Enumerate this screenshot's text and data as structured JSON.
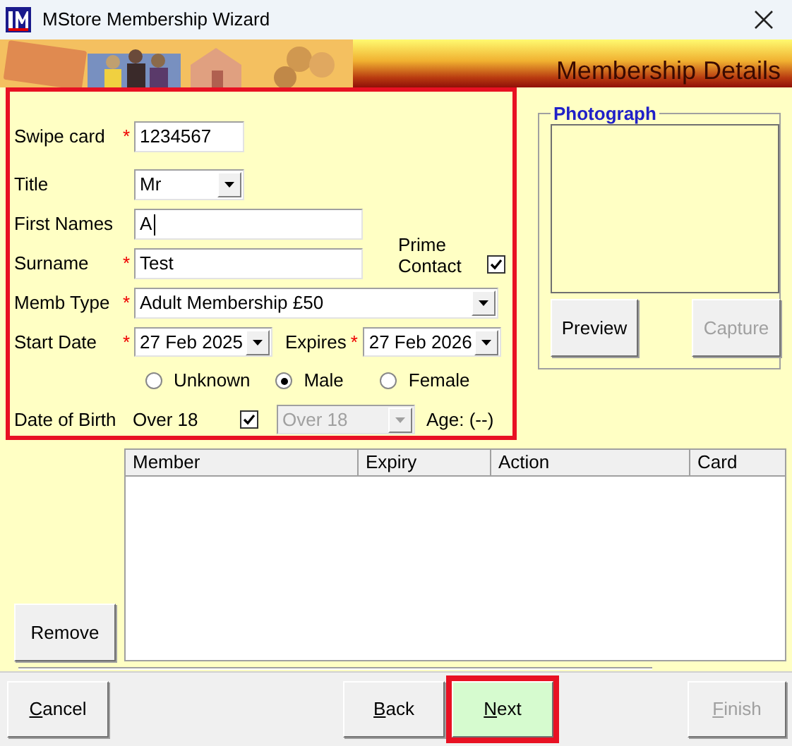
{
  "window": {
    "title": "MStore Membership Wizard"
  },
  "banner": {
    "title": "Membership Details"
  },
  "form": {
    "highlighted": true,
    "swipe_card": {
      "label": "Swipe card",
      "marker": "*",
      "value": "1234567"
    },
    "title": {
      "label": "Title",
      "value": "Mr"
    },
    "first_names": {
      "label": "First Names",
      "value": "A",
      "focused": true
    },
    "surname": {
      "label": "Surname",
      "marker": "*",
      "value": "Test"
    },
    "prime_contact": {
      "label": "Prime Contact",
      "checked": true
    },
    "memb_type": {
      "label": "Memb Type",
      "marker": "*",
      "value": "Adult Membership £50"
    },
    "start_date": {
      "label": "Start Date",
      "marker": "*",
      "value": "27 Feb 2025"
    },
    "expires": {
      "label": "Expires",
      "marker": "*",
      "value": "27 Feb 2026"
    },
    "gender": [
      {
        "label": "Unknown",
        "selected": false
      },
      {
        "label": "Male",
        "selected": true
      },
      {
        "label": "Female",
        "selected": false
      }
    ],
    "dob": {
      "label": "Date of Birth",
      "text": "Over 18",
      "checked": true,
      "select_value": "Over 18",
      "select_disabled": true,
      "age": "Age: (--)"
    }
  },
  "photograph": {
    "legend": "Photograph",
    "buttons": [
      {
        "label": "Preview",
        "disabled": false
      },
      {
        "label": "Capture",
        "disabled": true
      }
    ]
  },
  "members": {
    "columns": [
      "Member",
      "Expiry",
      "Action",
      "Card"
    ],
    "remove_button": "Remove"
  },
  "footer_buttons": [
    {
      "label": "Cancel",
      "mnemonic": true,
      "disabled": false,
      "default": false,
      "highlighted": false
    },
    {
      "label": "Back",
      "mnemonic": true,
      "disabled": false,
      "default": false,
      "highlighted": false
    },
    {
      "label": "Next",
      "mnemonic": true,
      "disabled": false,
      "default": true,
      "highlighted": true
    },
    {
      "label": "Finish",
      "mnemonic": true,
      "disabled": true,
      "default": false,
      "highlighted": false
    }
  ]
}
